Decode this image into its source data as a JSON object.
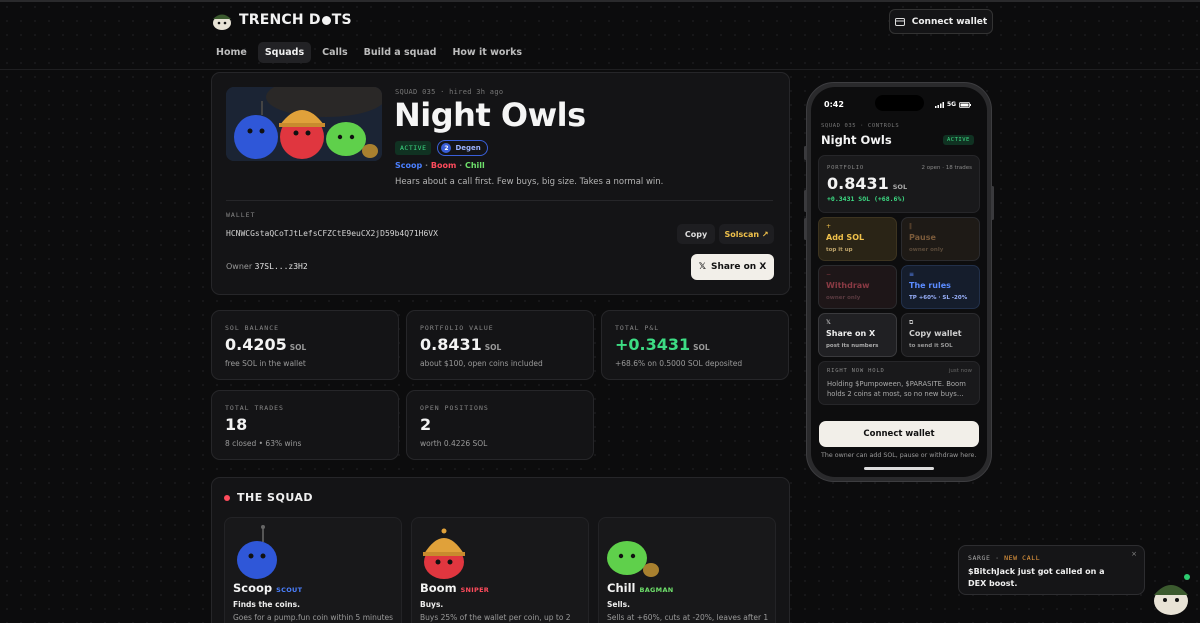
{
  "brand": {
    "name": "TRENCH D🟠TS",
    "name_left": "TRENCH D",
    "name_right": "TS"
  },
  "header": {
    "connect_label": "Connect  wallet"
  },
  "nav": [
    {
      "label": "Home",
      "active": false
    },
    {
      "label": "Squads",
      "active": true
    },
    {
      "label": "Calls",
      "active": false
    },
    {
      "label": "Build a squad",
      "active": false
    },
    {
      "label": "How it works",
      "active": false
    }
  ],
  "hero": {
    "meta": "SQUAD 035 · hired 3h ago",
    "title": "Night Owls",
    "status_badge": "ACTIVE",
    "level_number": "2",
    "level_label": "Degen",
    "members": [
      "Scoop",
      "Boom",
      "Chill"
    ],
    "separator": "·",
    "tagline": "Hears about a call first. Few buys, big size. Takes a normal win.",
    "wallet_label": "WALLET",
    "wallet_address": "HCNWCGstaQCoTJtLefsCFZCtE9euCX2jD59b4Q71H6VX",
    "copy_label": "Copy",
    "solscan_label": "Solscan ↗",
    "owner_label": "Owner",
    "owner_value": "37SL...z3H2",
    "share_label": "Share on X"
  },
  "stats": [
    {
      "label": "SOL BALANCE",
      "value": "0.4205",
      "unit": "SOL",
      "sub": "free SOL in the wallet",
      "color": "#f3f3f3"
    },
    {
      "label": "PORTFOLIO VALUE",
      "value": "0.8431",
      "unit": "SOL",
      "sub": "about $100, open coins included",
      "color": "#f3f3f3"
    },
    {
      "label": "TOTAL P&L",
      "value": "+0.3431",
      "unit": "SOL",
      "sub": "+68.6% on 0.5000 SOL deposited",
      "color": "#3ddc84"
    },
    {
      "label": "TOTAL TRADES",
      "value": "18",
      "unit": "",
      "sub": "8 closed • 63% wins",
      "color": "#f3f3f3"
    },
    {
      "label": "OPEN POSITIONS",
      "value": "2",
      "unit": "",
      "sub": "worth 0.4226 SOL",
      "color": "#f3f3f3"
    }
  ],
  "squad": {
    "heading": "THE SQUAD",
    "members": [
      {
        "name": "Scoop",
        "role": "SCOUT",
        "role_color": "#4b80ff",
        "desc": "Finds the coins.",
        "more": "Goes for a pump.fun coin within 5 minutes"
      },
      {
        "name": "Boom",
        "role": "SNIPER",
        "role_color": "#ff4b5c",
        "desc": "Buys.",
        "more": "Buys 25% of the wallet per coin, up to 2"
      },
      {
        "name": "Chill",
        "role": "BAGMAN",
        "role_color": "#6ee06b",
        "desc": "Sells.",
        "more": "Sells at +60%, cuts at -20%, leaves after 1"
      }
    ]
  },
  "phone": {
    "time": "0:42",
    "network": "5G",
    "meta": "SQUAD 035 · CONTROLS",
    "title": "Night Owls",
    "status": "ACTIVE",
    "portfolio_label": "PORTFOLIO",
    "portfolio_right": "2 open · 18 trades",
    "portfolio_value": "0.8431",
    "portfolio_unit": "SOL",
    "portfolio_change": "+0.3431 SOL (+68.6%)",
    "tiles": [
      {
        "icon": "+",
        "title": "Add SOL",
        "sub": "top it up",
        "bg": "#2a2416",
        "title_color": "#f0c14b",
        "sub_color": "#bda36a"
      },
      {
        "icon": "‖",
        "title": "Pause",
        "sub": "owner only",
        "bg": "#1e1a16",
        "title_color": "#7a5a3a",
        "sub_color": "#5a4a3a"
      },
      {
        "icon": "−",
        "title": "Withdraw",
        "sub": "owner only",
        "bg": "#1e1618",
        "title_color": "#8a3a44",
        "sub_color": "#5a3a40"
      },
      {
        "icon": "≡",
        "title": "The rules",
        "sub": "TP +60% · SL -20%",
        "bg": "#151d2c",
        "title_color": "#5b8cff",
        "sub_color": "#9bb3ff"
      },
      {
        "icon": "𝕏",
        "title": "Share on X",
        "sub": "post its numbers",
        "bg": "#202023",
        "title_color": "#f0f0f0",
        "sub_color": "#aaa"
      },
      {
        "icon": "⧉",
        "title": "Copy wallet",
        "sub": "to send it SOL",
        "bg": "#1a1a1c",
        "title_color": "#cfcfcf",
        "sub_color": "#999"
      }
    ],
    "now_label": "RIGHT NOW  HOLD",
    "now_time": "just now",
    "now_text": "Holding $Pumpoween, $PARASITE. Boom holds 2 coins at most, so no new buys…",
    "connect_label": "Connect wallet",
    "footer": "The owner can add SOL, pause or withdraw here."
  },
  "toast": {
    "head_name": "SARGE",
    "head_sep": "·",
    "head_tag": "NEW CALL",
    "message": "$BitchJack just got called on a DEX boost.",
    "close": "×"
  }
}
